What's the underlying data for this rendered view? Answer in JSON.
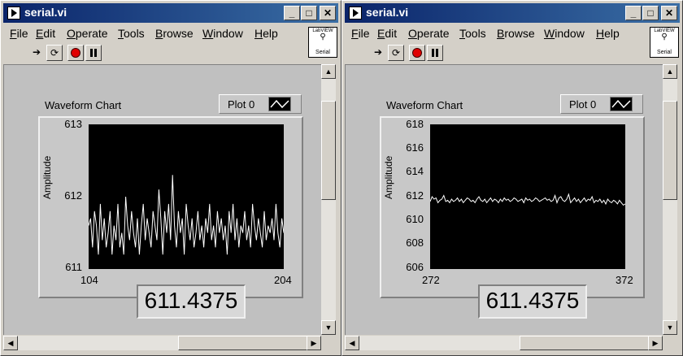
{
  "windows": [
    {
      "title": "serial.vi",
      "menu": [
        "File",
        "Edit",
        "Operate",
        "Tools",
        "Browse",
        "Window",
        "Help"
      ],
      "icon_text": {
        "top": "LabVIEW",
        "bottom": "Serial"
      },
      "chart": {
        "label": "Waveform Chart",
        "legend": "Plot 0",
        "ylabel": "Amplitude",
        "yticks": [
          "613",
          "612",
          "611"
        ],
        "xticks": [
          "104",
          "204"
        ],
        "digital": "611.4375"
      }
    },
    {
      "title": "serial.vi",
      "menu": [
        "File",
        "Edit",
        "Operate",
        "Tools",
        "Browse",
        "Window",
        "Help"
      ],
      "icon_text": {
        "top": "LabVIEW",
        "bottom": "Serial"
      },
      "chart": {
        "label": "Waveform Chart",
        "legend": "Plot 0",
        "ylabel": "Amplitude",
        "yticks": [
          "618",
          "616",
          "614",
          "612",
          "610",
          "608",
          "606"
        ],
        "xticks": [
          "272",
          "372"
        ],
        "digital": "611.4375"
      }
    }
  ],
  "chart_data": [
    {
      "type": "line",
      "ylim": [
        611,
        613
      ],
      "xlim": [
        104,
        204
      ],
      "series": [
        {
          "values": [
            611.6,
            611.7,
            611.3,
            611.8,
            611.6,
            611.2,
            611.9,
            611.4,
            611.7,
            611.3,
            611.5,
            611.8,
            611.2,
            611.6,
            611.4,
            611.9,
            611.3,
            611.5,
            611.2,
            612.0,
            611.6,
            611.4,
            611.8,
            611.5,
            611.3,
            611.7,
            611.2,
            611.6,
            611.9,
            611.4,
            611.7,
            611.5,
            611.3,
            611.8,
            611.6,
            611.4,
            612.1,
            611.7,
            611.2,
            611.8,
            611.5,
            611.9,
            611.4,
            612.3,
            611.6,
            611.3,
            611.8,
            611.5,
            611.7,
            611.2,
            611.9,
            611.6,
            611.4,
            611.7,
            611.3,
            611.5,
            611.8,
            611.4,
            611.6,
            611.3,
            611.7,
            611.5,
            611.9,
            611.4,
            611.6,
            611.3,
            611.8,
            611.5,
            611.7,
            611.4,
            611.6,
            611.2,
            611.8,
            611.5,
            611.9,
            611.4,
            611.7,
            611.3,
            611.6,
            611.5,
            611.8,
            611.4,
            611.6,
            611.3,
            611.9,
            611.6,
            611.4,
            611.7,
            611.5,
            611.3,
            611.8,
            611.4,
            611.6,
            611.5,
            611.7,
            611.4,
            611.9,
            611.5,
            611.3,
            611.7,
            611.5
          ]
        }
      ]
    },
    {
      "type": "line",
      "ylim": [
        606,
        618
      ],
      "xlim": [
        272,
        372
      ],
      "series": [
        {
          "values": [
            611.6,
            612.0,
            611.8,
            611.9,
            611.5,
            611.7,
            611.8,
            612.1,
            611.6,
            611.7,
            611.5,
            611.8,
            611.6,
            611.7,
            611.9,
            611.6,
            611.8,
            611.5,
            611.7,
            611.9,
            611.8,
            611.6,
            611.7,
            611.5,
            611.8,
            612.0,
            611.7,
            611.6,
            611.8,
            611.5,
            611.7,
            611.9,
            611.6,
            611.8,
            611.7,
            611.5,
            611.8,
            611.6,
            611.9,
            611.7,
            611.8,
            611.6,
            611.7,
            611.9,
            611.8,
            611.6,
            611.7,
            611.8,
            611.5,
            611.9,
            611.7,
            611.8,
            611.6,
            611.7,
            611.9,
            611.8,
            611.6,
            611.7,
            611.8,
            611.9,
            611.7,
            611.8,
            611.6,
            611.7,
            612.1,
            611.5,
            611.9,
            612.0,
            611.7,
            611.6,
            611.8,
            612.2,
            611.5,
            611.7,
            611.9,
            611.6,
            611.8,
            611.5,
            611.7,
            611.9,
            611.6,
            611.8,
            611.7,
            612.0,
            611.5,
            611.7,
            611.6,
            611.8,
            611.5,
            611.7,
            611.4,
            611.8,
            611.6,
            611.5,
            611.7,
            611.6,
            611.4,
            611.7,
            611.5,
            611.3,
            611.4
          ]
        }
      ]
    }
  ]
}
